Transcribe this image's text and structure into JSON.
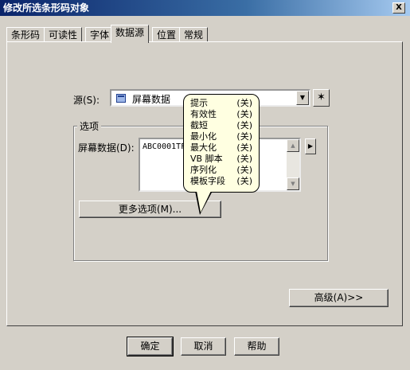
{
  "window": {
    "title": "修改所选条形码对象",
    "close_label": "X"
  },
  "tabs": [
    {
      "label": "条形码"
    },
    {
      "label": "可读性"
    },
    {
      "label": "字体"
    },
    {
      "label": "数据源"
    },
    {
      "label": "位置"
    },
    {
      "label": "常规"
    }
  ],
  "source": {
    "label": "源(S):",
    "selected": "屏幕数据",
    "icon": "screen-data-icon"
  },
  "options_group": {
    "title": "选项",
    "screen_data_label": "屏幕数据(D):",
    "screen_data_value": "ABC0001TF",
    "more_options_label": "更多选项(M)..."
  },
  "tooltip": {
    "items": [
      {
        "name": "提示",
        "state": "(关)"
      },
      {
        "name": "有效性",
        "state": "(关)"
      },
      {
        "name": "截短",
        "state": "(关)"
      },
      {
        "name": "最小化",
        "state": "(关)"
      },
      {
        "name": "最大化",
        "state": "(关)"
      },
      {
        "name": "VB 脚本",
        "state": "(关)"
      },
      {
        "name": "序列化",
        "state": "(关)"
      },
      {
        "name": "模板字段",
        "state": "(关)"
      }
    ]
  },
  "advanced_label": "高级(A)>>",
  "footer": {
    "ok_label": "确定",
    "cancel_label": "取消",
    "help_label": "帮助"
  }
}
